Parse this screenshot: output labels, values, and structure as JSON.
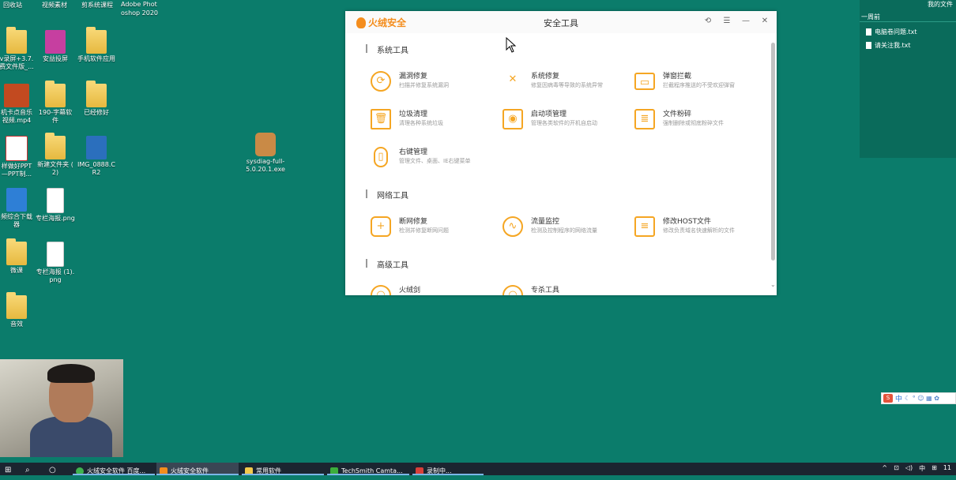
{
  "desktop": {
    "top_row": [
      "回收站",
      "视频素材",
      "剪系统课程",
      "Adobe Phot",
      "oshop 2020"
    ],
    "icons": [
      {
        "label": "v录屏+3.7.\n费文件版_..."
      },
      {
        "label": "安益投屏"
      },
      {
        "label": "手机软件应用"
      },
      {
        "label": "机卡点音乐\n视频.mp4"
      },
      {
        "label": "190-字幕软\n件"
      },
      {
        "label": "已经修好"
      },
      {
        "label": "样做好PPT\n—PPT制..."
      },
      {
        "label": "新建文件夹 (\n2)"
      },
      {
        "label": "IMG_0888.C\nR2"
      },
      {
        "label": "sysdiag-full-\n5.0.20.1.exe"
      },
      {
        "label": "频综合下载\n器"
      },
      {
        "label": "专栏海报.png"
      },
      {
        "label": "微课"
      },
      {
        "label": "专栏海报 (1).\npng"
      },
      {
        "label": "音效"
      }
    ]
  },
  "right_panel": {
    "title": "我的文件",
    "week": "一周前",
    "files": [
      "电脑卷问题.txt",
      "请关注我.txt"
    ]
  },
  "ime": {
    "lang": "中",
    "icons": "☾ ° ☺ ▦ ✿"
  },
  "window": {
    "brand": "火绒安全",
    "title": "安全工具",
    "controls": [
      "⟲",
      "☰",
      "—",
      "✕"
    ],
    "sections": [
      {
        "title": "系统工具"
      },
      {
        "title": "网络工具"
      },
      {
        "title": "高级工具"
      }
    ],
    "tools": [
      {
        "name": "漏洞修复",
        "desc": "扫描并修复系统漏洞",
        "icon": "refresh-icon",
        "glyph": "⟳"
      },
      {
        "name": "系统修复",
        "desc": "修复因病毒等导致的系统异常",
        "icon": "wrench-icon",
        "glyph": "✕"
      },
      {
        "name": "弹窗拦截",
        "desc": "拦截程序推送的不受欢迎弹窗",
        "icon": "window-icon",
        "glyph": "▭"
      },
      {
        "name": "垃圾清理",
        "desc": "清理各种系统垃圾",
        "icon": "trash-icon",
        "glyph": "🗑"
      },
      {
        "name": "启动项管理",
        "desc": "管理各类软件的开机自启动",
        "icon": "monitor-icon",
        "glyph": "◉"
      },
      {
        "name": "文件粉碎",
        "desc": "强制删除或彻底粉碎文件",
        "icon": "shredder-icon",
        "glyph": "≣"
      },
      {
        "name": "右键管理",
        "desc": "管理文件、桌面、IE右键菜单",
        "icon": "mouse-icon",
        "glyph": "▯"
      },
      {
        "name": "断网修复",
        "desc": "检测并修复断网问题",
        "icon": "firstaid-icon",
        "glyph": "+"
      },
      {
        "name": "流量监控",
        "desc": "检测及控制程序的网络流量",
        "icon": "pulse-icon",
        "glyph": "∿"
      },
      {
        "name": "修改HOST文件",
        "desc": "修改负责域名快速解析的文件",
        "icon": "document-icon",
        "glyph": "≡"
      },
      {
        "name": "火绒剑",
        "desc": "",
        "icon": "sword-icon",
        "glyph": "◠"
      },
      {
        "name": "专杀工具",
        "desc": "",
        "icon": "kill-icon",
        "glyph": "◠"
      }
    ]
  },
  "taskbar": {
    "items": [
      "火绒安全软件 百度...",
      "火绒安全软件",
      "常用软件",
      "TechSmith Camta...",
      "录制中..."
    ],
    "tray": [
      "^",
      "⊡",
      "◁)",
      "中",
      "⊞",
      "11"
    ]
  }
}
